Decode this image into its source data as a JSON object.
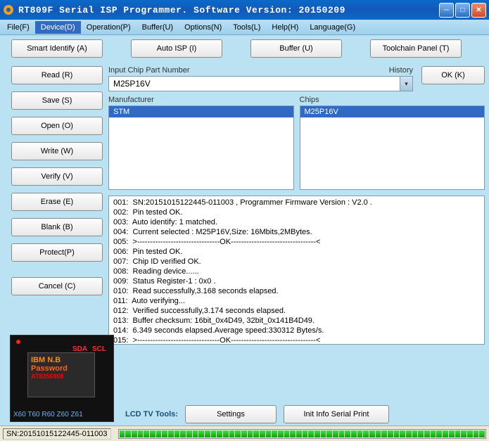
{
  "window": {
    "title": "RT809F Serial ISP Programmer. Software Version: 20150209"
  },
  "menu": {
    "file": "File(F)",
    "device": "Device(D)",
    "operation": "Operation(P)",
    "buffer": "Buffer(U)",
    "options": "Options(N)",
    "tools": "Tools(L)",
    "help": "Help(H)",
    "language": "Language(G)"
  },
  "topbuttons": {
    "smart": "Smart Identify (A)",
    "autoisp": "Auto ISP (I)",
    "buffer": "Buffer (U)",
    "toolchain": "Toolchain Panel (T)"
  },
  "sidebuttons": {
    "read": "Read (R)",
    "save": "Save (S)",
    "open": "Open (O)",
    "write": "Write (W)",
    "verify": "Verify (V)",
    "erase": "Erase (E)",
    "blank": "Blank (B)",
    "protect": "Protect(P)",
    "cancel": "Cancel (C)"
  },
  "input": {
    "label": "Input Chip Part Number",
    "history": "History",
    "value": "M25P16V",
    "ok": "OK (K)"
  },
  "lists": {
    "manufacturer_label": "Manufacturer",
    "manufacturer": [
      "STM"
    ],
    "chips_label": "Chips",
    "chips": [
      "M25P16V"
    ]
  },
  "log": [
    "001:  SN:20151015122445-011003 , Programmer Firmware Version : V2.0 .",
    "002:  Pin tested OK.",
    "003:  Auto identify: 1 matched.",
    "004:  Current selected : M25P16V,Size: 16Mbits,2MBytes.",
    "005:  >--------------------------------OK---------------------------------<",
    "006:  Pin tested OK.",
    "007:  Chip ID verified OK.",
    "008:  Reading device......",
    "009:  Status Register-1 : 0x0 .",
    "010:  Read successfully,3.168 seconds elapsed.",
    "011:  Auto verifying...",
    "012:  Verified successfully,3.174 seconds elapsed.",
    "013:  Buffer checksum: 16bit_0x4D49, 32bit_0x141B4D49.",
    "014:  6.349 seconds elapsed.Average speed:330312 Bytes/s.",
    "015:  >--------------------------------OK---------------------------------<"
  ],
  "chip": {
    "sda": "SDA",
    "scl": "SCL",
    "line1": "IBM  N.B",
    "line2": "Password",
    "line3": "AT8356908",
    "tags": "X60 T60 R60 Z60 Z61"
  },
  "bottom": {
    "lcd": "LCD TV Tools:",
    "settings": "Settings",
    "init": "Init Info Serial Print"
  },
  "status": {
    "sn": "SN:20151015122445-011003"
  }
}
